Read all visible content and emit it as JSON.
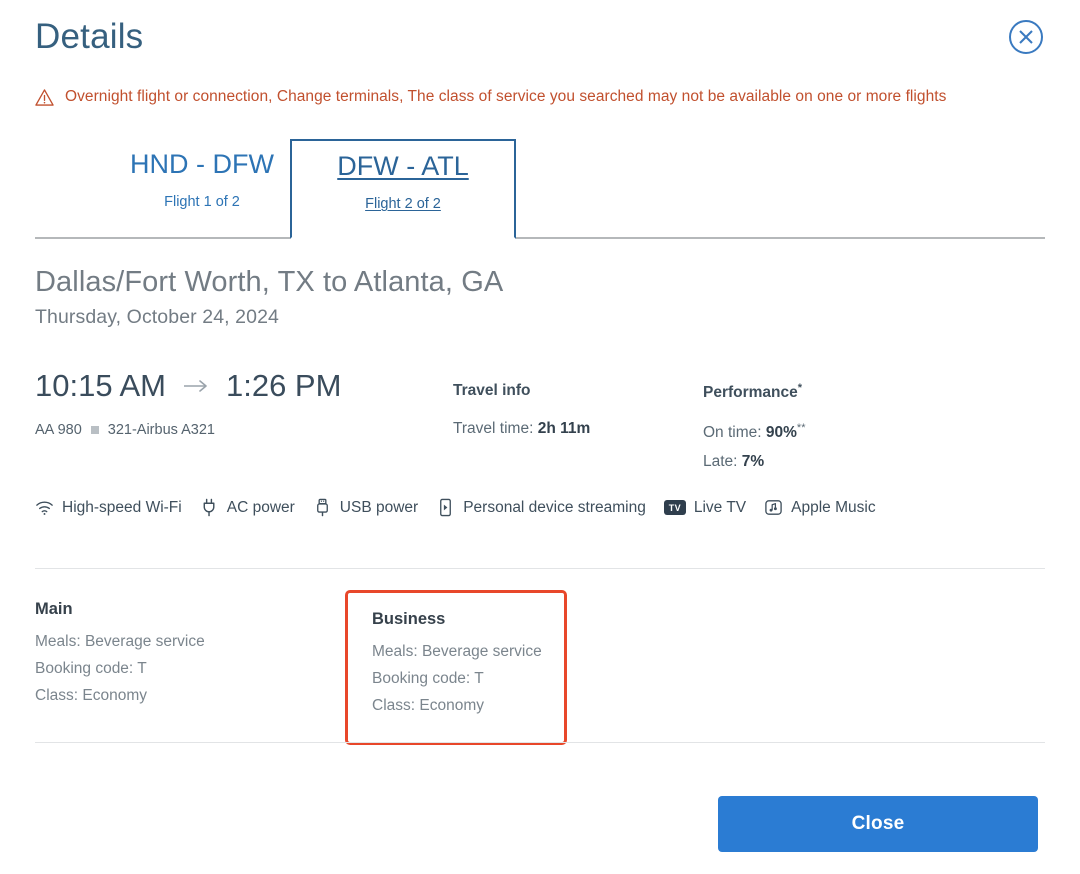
{
  "header": {
    "title": "Details",
    "close_icon": "close-circle-icon"
  },
  "alert": {
    "icon": "warning-triangle-icon",
    "text": "Overnight flight or connection, Change terminals, The class of service you searched may not be available on one or more flights",
    "color": "#c1502e"
  },
  "tabs": [
    {
      "route": "HND - DFW",
      "sub": "Flight 1 of 2",
      "active": false
    },
    {
      "route": "DFW - ATL",
      "sub": "Flight 2 of 2",
      "active": true
    }
  ],
  "flight": {
    "route_title": "Dallas/Fort Worth, TX to Atlanta, GA",
    "date": "Thursday, October 24, 2024",
    "depart_time": "10:15 AM",
    "arrive_time": "1:26 PM",
    "arrow_icon": "arrow-right-icon",
    "flight_number": "AA 980",
    "aircraft": "321-Airbus A321"
  },
  "travel_info": {
    "heading": "Travel info",
    "travel_time_label": "Travel time:",
    "travel_time_value": "2h 11m"
  },
  "performance": {
    "heading": "Performance",
    "heading_sup": "*",
    "on_time_label": "On time:",
    "on_time_value": "90%",
    "on_time_sup": "**",
    "late_label": "Late:",
    "late_value": "7%"
  },
  "amenities": [
    {
      "icon": "wifi-icon",
      "label": "High-speed Wi-Fi"
    },
    {
      "icon": "ac-power-icon",
      "label": "AC power"
    },
    {
      "icon": "usb-power-icon",
      "label": "USB power"
    },
    {
      "icon": "personal-device-icon",
      "label": "Personal device streaming"
    },
    {
      "icon": "live-tv-icon",
      "label": "Live TV",
      "badge": "TV"
    },
    {
      "icon": "apple-music-icon",
      "label": "Apple Music"
    }
  ],
  "cabins": [
    {
      "name": "Main",
      "meals": "Meals: Beverage service",
      "booking_code": "Booking code: T",
      "class": "Class: Economy",
      "highlighted": false
    },
    {
      "name": "Business",
      "meals": "Meals: Beverage service",
      "booking_code": "Booking code: T",
      "class": "Class: Economy",
      "highlighted": true,
      "highlight_color": "#e8472a"
    }
  ],
  "footer": {
    "close_label": "Close",
    "close_color": "#2b7cd3"
  }
}
